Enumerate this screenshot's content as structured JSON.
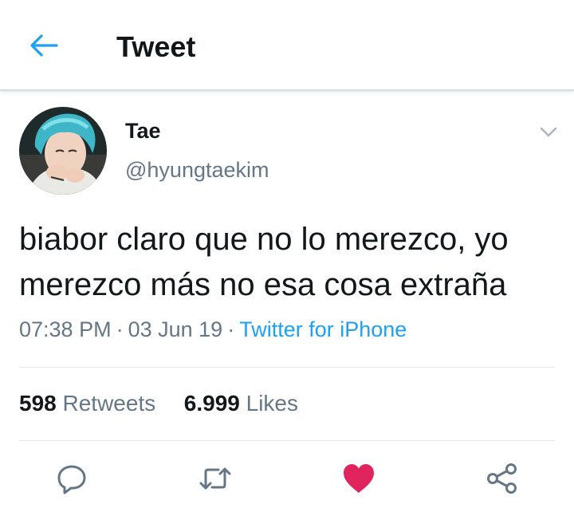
{
  "header": {
    "title": "Tweet",
    "back_icon": "arrow-left-icon"
  },
  "tweet": {
    "author": {
      "name": "Tae",
      "handle": "@hyungtaekim"
    },
    "text": "biabor claro que no lo merezco, yo\nmerezco más no esa cosa extraña",
    "time": "07:38 PM",
    "date": "03 Jun 19",
    "separator": "·",
    "source": "Twitter for iPhone",
    "stats": {
      "retweets_count": "598",
      "retweets_label": "Retweets",
      "likes_count": "6.999",
      "likes_label": "Likes"
    },
    "actions": [
      "reply-icon",
      "retweet-icon",
      "like-icon",
      "share-icon"
    ]
  },
  "colors": {
    "accent": "#1da1f2",
    "like": "#e0245e",
    "secondary_text": "#657786",
    "icon_gray": "#657786"
  }
}
